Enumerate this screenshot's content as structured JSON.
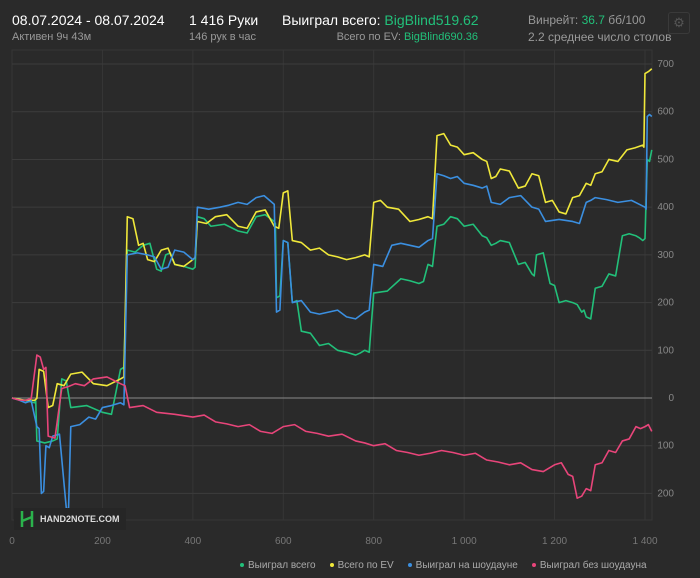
{
  "header": {
    "date_range": "08.07.2024 - 08.07.2024",
    "active": "Активен 9ч 43м",
    "hands": "1 416 Руки",
    "hands_per_hour": "146 рук в час",
    "won_total_label": "Выиграл всего:",
    "won_total_value": "BigBlind519.62",
    "ev_label": "Всего по EV:",
    "ev_value": "BigBlind690.36",
    "winrate_label": "Винрейт:",
    "winrate_value": "36.7",
    "winrate_unit": "бб/100",
    "avg_tables": "2.2 среднее число столов"
  },
  "logo_text": "HAND2NOTE.COM",
  "chart_data": {
    "type": "line",
    "xlim": [
      0,
      1415
    ],
    "ylim": [
      -250,
      730
    ],
    "x_ticks": [
      0,
      200,
      400,
      600,
      800,
      1000,
      1200,
      1400
    ],
    "x_tick_labels": [
      "0",
      "200",
      "400",
      "600",
      "800",
      "1 000",
      "1 200",
      "1 400"
    ],
    "y_ticks": [
      700,
      600,
      500,
      400,
      300,
      200,
      100,
      0,
      -100,
      -200
    ],
    "y_tick_labels": [
      "700",
      "600",
      "500",
      "400",
      "300",
      "200",
      "100",
      "0",
      "100",
      "200"
    ],
    "grid": true,
    "legend_position": "bottom-right",
    "series": [
      {
        "name": "Выиграл всего",
        "color": "#22c07a",
        "points": [
          [
            0,
            0
          ],
          [
            50,
            -10
          ],
          [
            55,
            -90
          ],
          [
            90,
            -90
          ],
          [
            110,
            40
          ],
          [
            130,
            -20
          ],
          [
            200,
            -30
          ],
          [
            240,
            60
          ],
          [
            255,
            310
          ],
          [
            290,
            320
          ],
          [
            320,
            270
          ],
          [
            340,
            300
          ],
          [
            360,
            280
          ],
          [
            400,
            270
          ],
          [
            410,
            380
          ],
          [
            440,
            360
          ],
          [
            500,
            350
          ],
          [
            540,
            380
          ],
          [
            580,
            370
          ],
          [
            585,
            210
          ],
          [
            600,
            330
          ],
          [
            620,
            200
          ],
          [
            640,
            140
          ],
          [
            680,
            110
          ],
          [
            720,
            100
          ],
          [
            760,
            90
          ],
          [
            780,
            100
          ],
          [
            800,
            220
          ],
          [
            860,
            250
          ],
          [
            900,
            240
          ],
          [
            920,
            280
          ],
          [
            940,
            360
          ],
          [
            970,
            380
          ],
          [
            1000,
            360
          ],
          [
            1040,
            340
          ],
          [
            1060,
            320
          ],
          [
            1080,
            330
          ],
          [
            1120,
            280
          ],
          [
            1150,
            260
          ],
          [
            1160,
            300
          ],
          [
            1190,
            240
          ],
          [
            1210,
            200
          ],
          [
            1240,
            200
          ],
          [
            1260,
            180
          ],
          [
            1270,
            170
          ],
          [
            1290,
            230
          ],
          [
            1320,
            260
          ],
          [
            1350,
            340
          ],
          [
            1380,
            340
          ],
          [
            1395,
            330
          ],
          [
            1405,
            500
          ],
          [
            1415,
            520
          ]
        ]
      },
      {
        "name": "Всего по EV",
        "color": "#f0e83a",
        "points": [
          [
            0,
            0
          ],
          [
            50,
            -5
          ],
          [
            60,
            60
          ],
          [
            80,
            -20
          ],
          [
            100,
            30
          ],
          [
            130,
            50
          ],
          [
            180,
            30
          ],
          [
            240,
            40
          ],
          [
            255,
            380
          ],
          [
            280,
            320
          ],
          [
            300,
            290
          ],
          [
            330,
            310
          ],
          [
            360,
            280
          ],
          [
            400,
            290
          ],
          [
            410,
            370
          ],
          [
            450,
            380
          ],
          [
            500,
            360
          ],
          [
            540,
            390
          ],
          [
            580,
            360
          ],
          [
            600,
            430
          ],
          [
            620,
            330
          ],
          [
            660,
            310
          ],
          [
            700,
            300
          ],
          [
            740,
            290
          ],
          [
            780,
            300
          ],
          [
            800,
            410
          ],
          [
            830,
            400
          ],
          [
            880,
            370
          ],
          [
            920,
            380
          ],
          [
            940,
            550
          ],
          [
            970,
            530
          ],
          [
            1000,
            510
          ],
          [
            1040,
            500
          ],
          [
            1060,
            460
          ],
          [
            1080,
            480
          ],
          [
            1120,
            440
          ],
          [
            1150,
            470
          ],
          [
            1180,
            410
          ],
          [
            1210,
            390
          ],
          [
            1240,
            420
          ],
          [
            1270,
            450
          ],
          [
            1290,
            470
          ],
          [
            1320,
            500
          ],
          [
            1360,
            520
          ],
          [
            1395,
            530
          ],
          [
            1400,
            680
          ],
          [
            1415,
            690
          ]
        ]
      },
      {
        "name": "Выиграл на шоудауне",
        "color": "#3b8fe0",
        "points": [
          [
            0,
            0
          ],
          [
            30,
            -10
          ],
          [
            55,
            -60
          ],
          [
            65,
            -200
          ],
          [
            75,
            -100
          ],
          [
            90,
            -80
          ],
          [
            120,
            -230
          ],
          [
            130,
            -60
          ],
          [
            170,
            -40
          ],
          [
            200,
            -20
          ],
          [
            240,
            -10
          ],
          [
            255,
            300
          ],
          [
            300,
            300
          ],
          [
            330,
            270
          ],
          [
            360,
            310
          ],
          [
            400,
            290
          ],
          [
            410,
            400
          ],
          [
            460,
            400
          ],
          [
            500,
            410
          ],
          [
            540,
            420
          ],
          [
            575,
            410
          ],
          [
            585,
            180
          ],
          [
            600,
            330
          ],
          [
            620,
            200
          ],
          [
            660,
            180
          ],
          [
            700,
            180
          ],
          [
            740,
            170
          ],
          [
            780,
            180
          ],
          [
            800,
            280
          ],
          [
            840,
            320
          ],
          [
            880,
            320
          ],
          [
            920,
            330
          ],
          [
            940,
            470
          ],
          [
            970,
            460
          ],
          [
            1000,
            450
          ],
          [
            1040,
            440
          ],
          [
            1060,
            410
          ],
          [
            1100,
            420
          ],
          [
            1150,
            400
          ],
          [
            1180,
            370
          ],
          [
            1240,
            370
          ],
          [
            1270,
            410
          ],
          [
            1290,
            420
          ],
          [
            1340,
            410
          ],
          [
            1400,
            400
          ],
          [
            1405,
            590
          ],
          [
            1415,
            590
          ]
        ]
      },
      {
        "name": "Выиграл без шоудауна",
        "color": "#e8457a",
        "points": [
          [
            0,
            0
          ],
          [
            30,
            -5
          ],
          [
            55,
            90
          ],
          [
            70,
            60
          ],
          [
            80,
            -80
          ],
          [
            110,
            20
          ],
          [
            140,
            30
          ],
          [
            180,
            40
          ],
          [
            240,
            30
          ],
          [
            260,
            -20
          ],
          [
            320,
            -30
          ],
          [
            400,
            -40
          ],
          [
            450,
            -50
          ],
          [
            500,
            -60
          ],
          [
            550,
            -70
          ],
          [
            600,
            -60
          ],
          [
            650,
            -70
          ],
          [
            700,
            -80
          ],
          [
            760,
            -90
          ],
          [
            800,
            -100
          ],
          [
            850,
            -110
          ],
          [
            900,
            -120
          ],
          [
            950,
            -110
          ],
          [
            1000,
            -120
          ],
          [
            1050,
            -130
          ],
          [
            1100,
            -140
          ],
          [
            1150,
            -150
          ],
          [
            1200,
            -140
          ],
          [
            1230,
            -160
          ],
          [
            1250,
            -210
          ],
          [
            1270,
            -190
          ],
          [
            1290,
            -140
          ],
          [
            1320,
            -110
          ],
          [
            1350,
            -90
          ],
          [
            1380,
            -60
          ],
          [
            1400,
            -60
          ],
          [
            1415,
            -70
          ]
        ]
      }
    ]
  }
}
